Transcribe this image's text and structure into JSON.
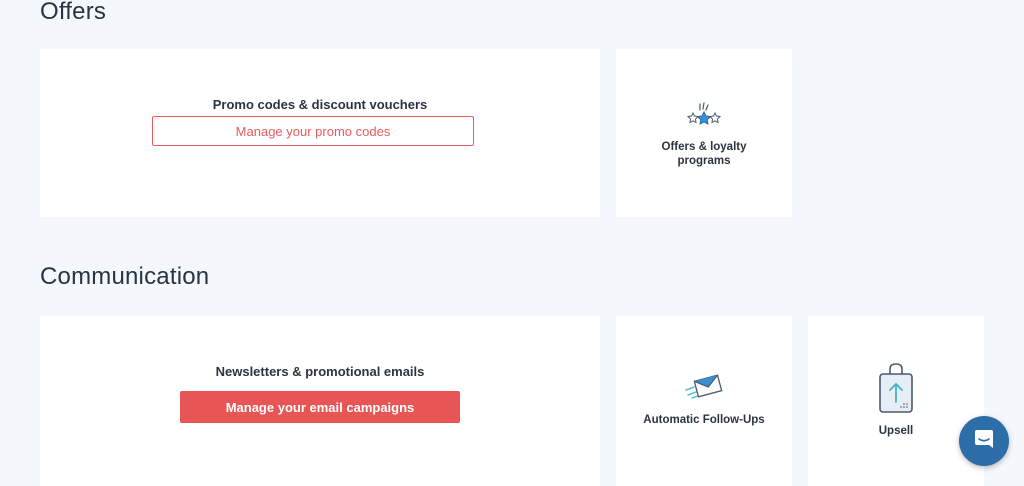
{
  "sections": {
    "offers": {
      "title": "Offers",
      "main_card": {
        "title": "Promo codes & discount vouchers",
        "button_label": "Manage your promo codes"
      },
      "tiles": [
        {
          "label": "Offers & loyalty programs",
          "icon": "stars-icon"
        }
      ]
    },
    "communication": {
      "title": "Communication",
      "main_card": {
        "title": "Newsletters & promotional emails",
        "button_label": "Manage your email campaigns"
      },
      "tiles": [
        {
          "label": "Automatic Follow-Ups",
          "icon": "email-send-icon"
        },
        {
          "label": "Upsell",
          "icon": "shopping-bag-upsell-icon"
        }
      ]
    }
  },
  "chat": {
    "icon": "chat-bubble-icon"
  },
  "colors": {
    "accent": "#e85555",
    "background": "#f4f7fb",
    "chat_button": "#2d6ea9",
    "text": "#2b3441"
  }
}
